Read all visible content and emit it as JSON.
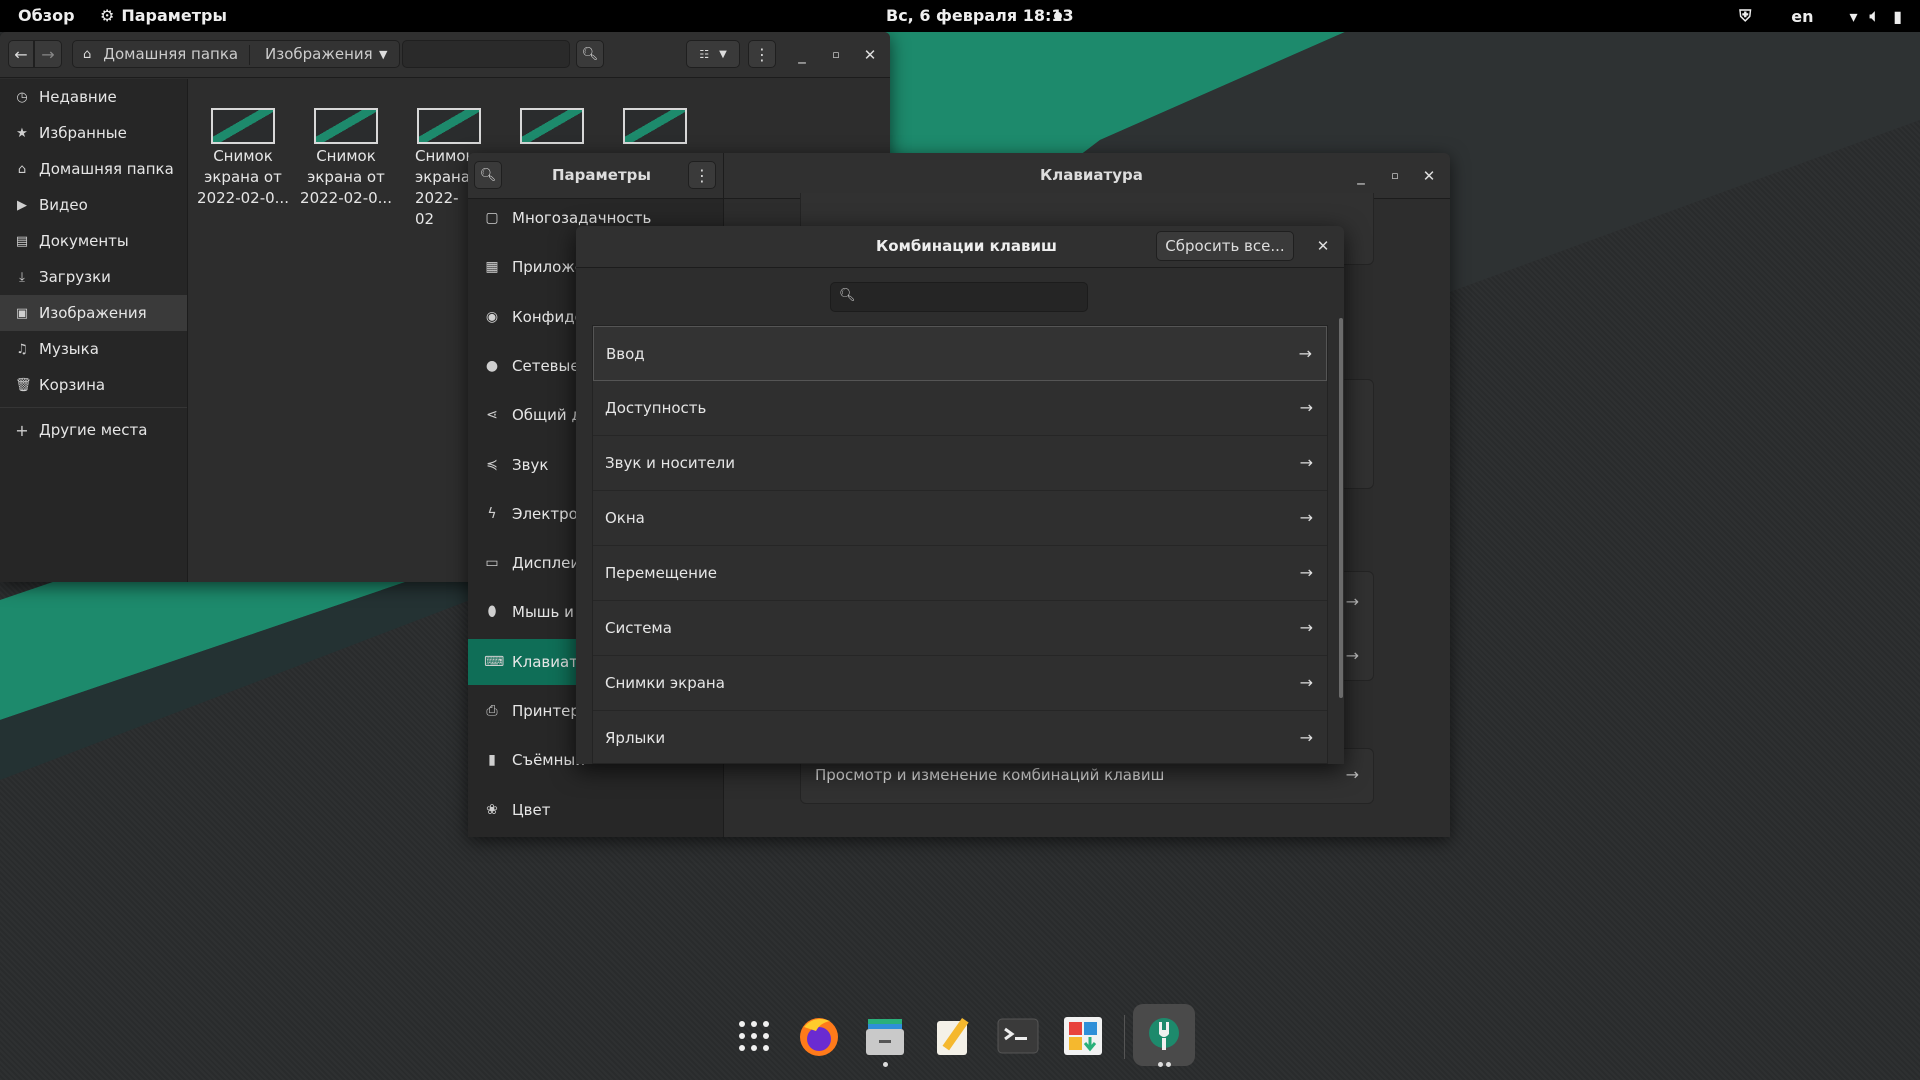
{
  "colors": {
    "accent": "#1d8a6c",
    "topbar": "#000000",
    "panel": "#2d2d2d",
    "selected": "#0f6e57"
  },
  "topbar": {
    "activities": "Обзор",
    "app_menu": "Параметры",
    "clock": "Вс, 6 февраля  18:13",
    "lang": "en"
  },
  "files": {
    "breadcrumb": [
      "Домашняя папка",
      "Изображения"
    ],
    "sidebar": [
      {
        "label": "Недавние",
        "icon": "clock-icon"
      },
      {
        "label": "Избранные",
        "icon": "star-icon"
      },
      {
        "label": "Домашняя папка",
        "icon": "home-icon"
      },
      {
        "label": "Видео",
        "icon": "video-icon"
      },
      {
        "label": "Документы",
        "icon": "document-icon"
      },
      {
        "label": "Загрузки",
        "icon": "download-icon"
      },
      {
        "label": "Изображения",
        "icon": "image-icon"
      },
      {
        "label": "Музыка",
        "icon": "music-icon"
      },
      {
        "label": "Корзина",
        "icon": "trash-icon"
      }
    ],
    "other_places": "Другие места",
    "thumbnails": [
      {
        "line1": "Снимок",
        "line2": "экрана от",
        "line3": "2022-02-0..."
      },
      {
        "line1": "Снимок",
        "line2": "экрана от",
        "line3": "2022-02-0..."
      },
      {
        "line1": "Снимок",
        "line2": "экрана",
        "line3": "2022-02"
      }
    ]
  },
  "settings": {
    "title": "Параметры",
    "panel_title": "Клавиатура",
    "sidebar": [
      {
        "label": "Многозадачность"
      },
      {
        "label": "Приложе"
      },
      {
        "label": "Конфиде"
      },
      {
        "label": "Сетевые"
      },
      {
        "label": "Общий д"
      },
      {
        "label": "Звук"
      },
      {
        "label": "Электрог"
      },
      {
        "label": "Дисплеи"
      },
      {
        "label": "Мышь и"
      },
      {
        "label": "Клавиату"
      },
      {
        "label": "Принтер"
      },
      {
        "label": "Съёмный"
      },
      {
        "label": "Цвет"
      }
    ],
    "shortcut_row": "Просмотр и изменение комбинаций клавиш"
  },
  "dialog": {
    "title": "Комбинации клавиш",
    "reset_label": "Сбросить все...",
    "search_placeholder": "",
    "categories": [
      "Ввод",
      "Доступность",
      "Звук и носители",
      "Окна",
      "Перемещение",
      "Система",
      "Снимки экрана",
      "Ярлыки"
    ]
  },
  "dock": [
    "app-grid-icon",
    "firefox-icon",
    "files-icon",
    "text-editor-icon",
    "terminal-icon",
    "software-icon",
    "settings-icon"
  ]
}
